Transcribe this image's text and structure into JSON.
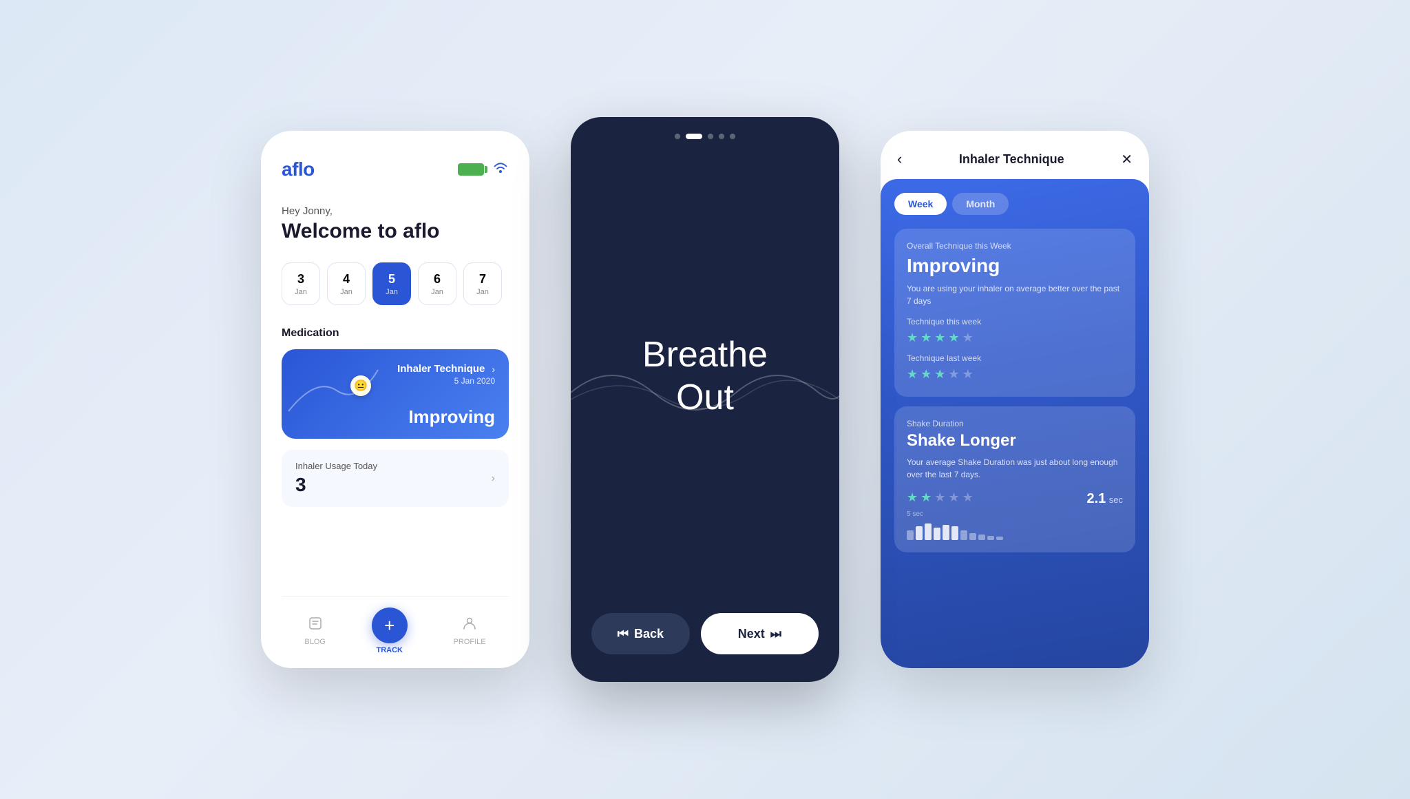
{
  "app": {
    "brand": "aflo"
  },
  "phone1": {
    "greeting": "Hey Jonny,",
    "welcome": "Welcome to aflo",
    "dates": [
      {
        "num": "3",
        "month": "Jan",
        "active": false
      },
      {
        "num": "4",
        "month": "Jan",
        "active": false
      },
      {
        "num": "5",
        "month": "Jan",
        "active": true
      },
      {
        "num": "6",
        "month": "Jan",
        "active": false
      },
      {
        "num": "7",
        "month": "Jan",
        "active": false
      }
    ],
    "medication_label": "Medication",
    "inhaler_card": {
      "title": "Inhaler Technique",
      "date": "5 Jan 2020",
      "status": "Improving"
    },
    "usage": {
      "label": "Inhaler Usage Today",
      "count": "3"
    },
    "nav": {
      "blog": "BLOG",
      "track": "TRACK",
      "profile": "PROFILE"
    }
  },
  "phone2": {
    "dots": [
      false,
      true,
      false,
      false,
      false
    ],
    "breathe_line1": "Breathe",
    "breathe_line2": "Out",
    "back_label": "Back",
    "next_label": "Next"
  },
  "phone3": {
    "title": "Inhaler Technique",
    "tabs": [
      "Week",
      "Month"
    ],
    "active_tab": "Week",
    "technique_card": {
      "subtitle": "Overall Technique this Week",
      "main": "Improving",
      "desc": "You are using your inhaler on average better over the past 7 days",
      "this_week_label": "Technique this week",
      "this_week_stars": [
        true,
        true,
        true,
        true,
        false
      ],
      "last_week_label": "Technique last week",
      "last_week_stars": [
        true,
        true,
        true,
        false,
        false
      ]
    },
    "shake_card": {
      "label": "Shake Duration",
      "title": "Shake Longer",
      "desc": "Your average Shake Duration was just about long enough over the last 7 days.",
      "stars": [
        true,
        true,
        false,
        false,
        false
      ],
      "seconds": "2.1",
      "unit": "sec",
      "bar_label": "5 sec",
      "bars": [
        false,
        true,
        true,
        true,
        true,
        true,
        false,
        false,
        false,
        false,
        false
      ]
    }
  }
}
